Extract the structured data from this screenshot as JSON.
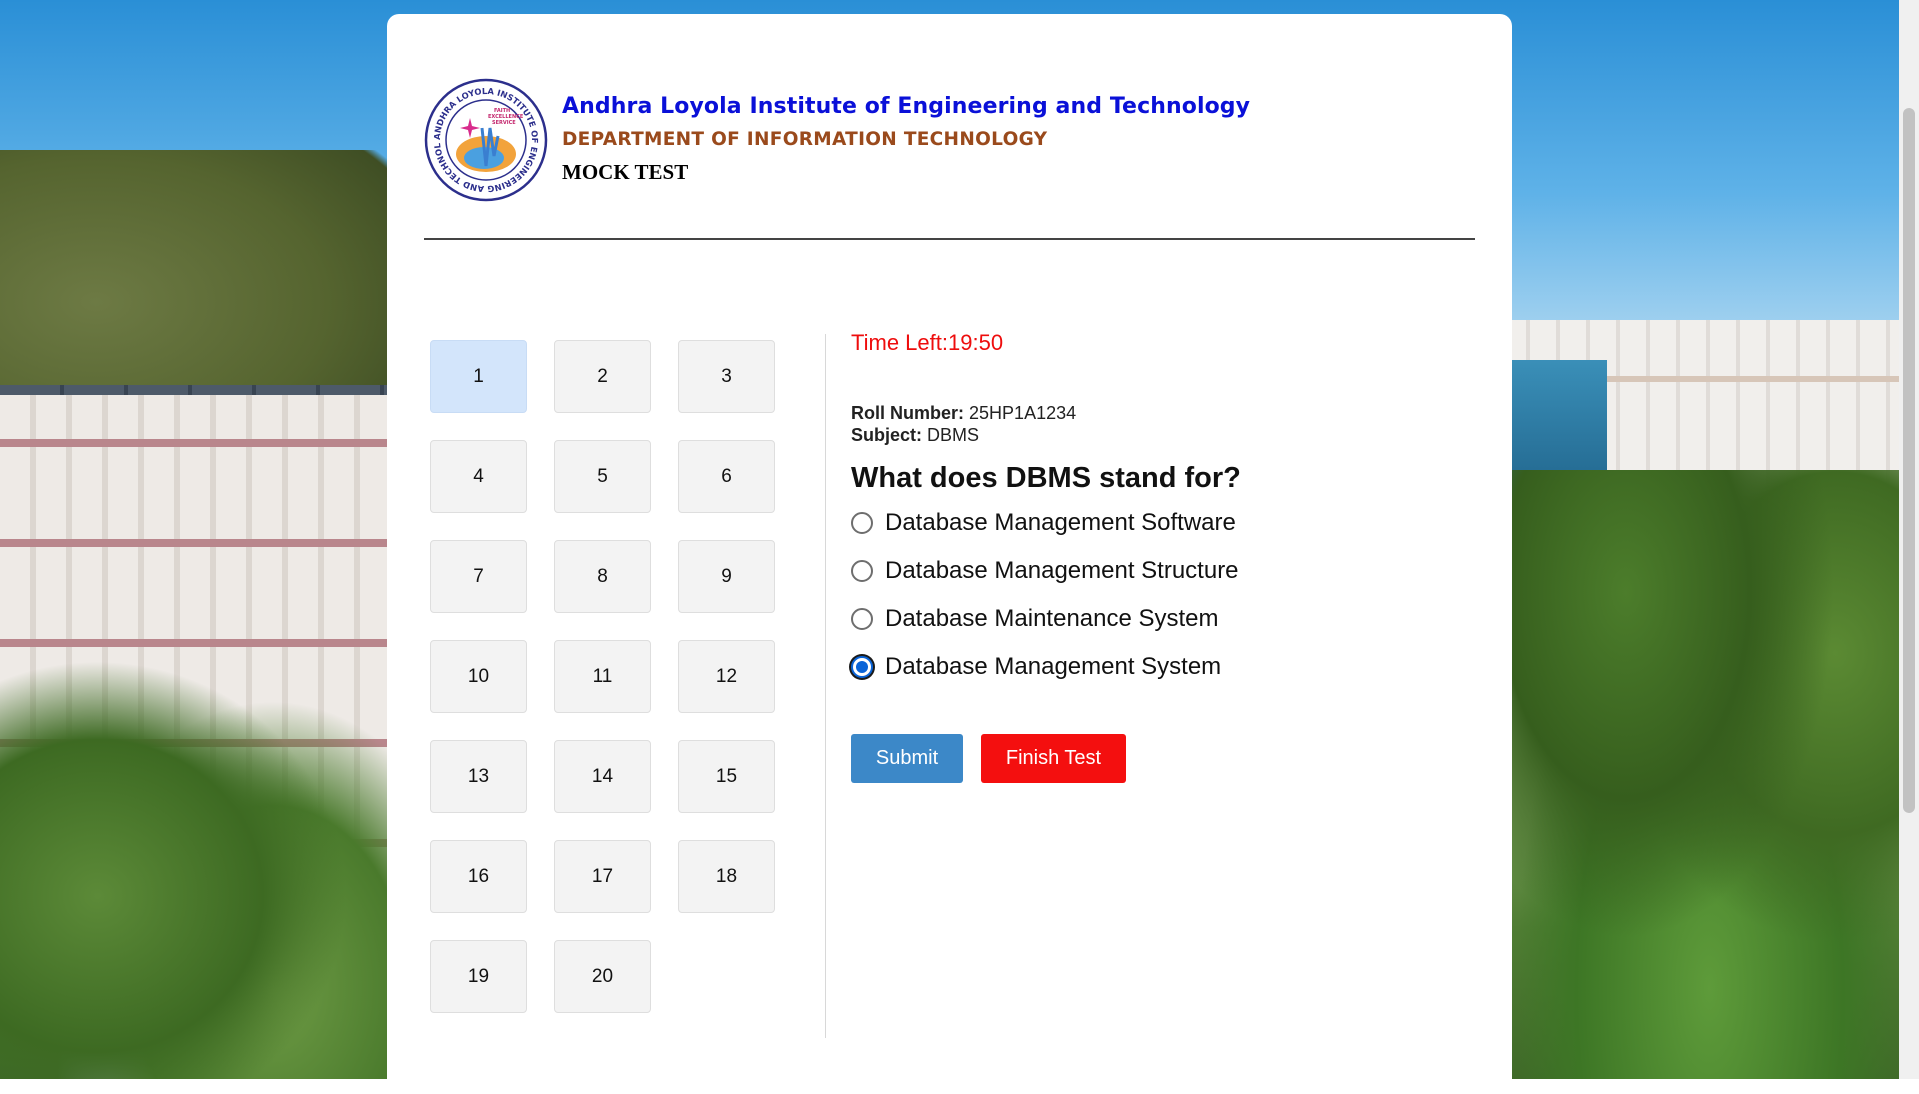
{
  "header": {
    "institute": "Andhra Loyola Institute of Engineering and Technology",
    "department": "DEPARTMENT OF INFORMATION TECHNOLOGY",
    "subtitle": "MOCK TEST",
    "logo": {
      "ring_text": "ANDHRA LOYOLA INSTITUTE OF ENGINEERING AND TECHNOLOGY",
      "motto": [
        "FAITH",
        "EXCELLENCE",
        "SERVICE"
      ]
    }
  },
  "navigator": {
    "questions": [
      "1",
      "2",
      "3",
      "4",
      "5",
      "6",
      "7",
      "8",
      "9",
      "10",
      "11",
      "12",
      "13",
      "14",
      "15",
      "16",
      "17",
      "18",
      "19",
      "20"
    ],
    "active": "1"
  },
  "exam": {
    "timer_label": "Time Left:",
    "timer_value": "19:50",
    "roll_label": "Roll Number:",
    "roll_value": "25HP1A1234",
    "subject_label": "Subject:",
    "subject_value": "DBMS",
    "question": "What does DBMS stand for?",
    "options": [
      "Database Management Software",
      "Database Management Structure",
      "Database Maintenance System",
      "Database Management System"
    ],
    "selected_option": 3,
    "submit_label": "Submit",
    "finish_label": "Finish Test"
  },
  "colors": {
    "institute": "#0a10d8",
    "department": "#9a4a1c",
    "timer": "#ee0d0d",
    "submit": "#3c88c8",
    "finish": "#f40f0f",
    "active_question": "#d3e5fb"
  }
}
